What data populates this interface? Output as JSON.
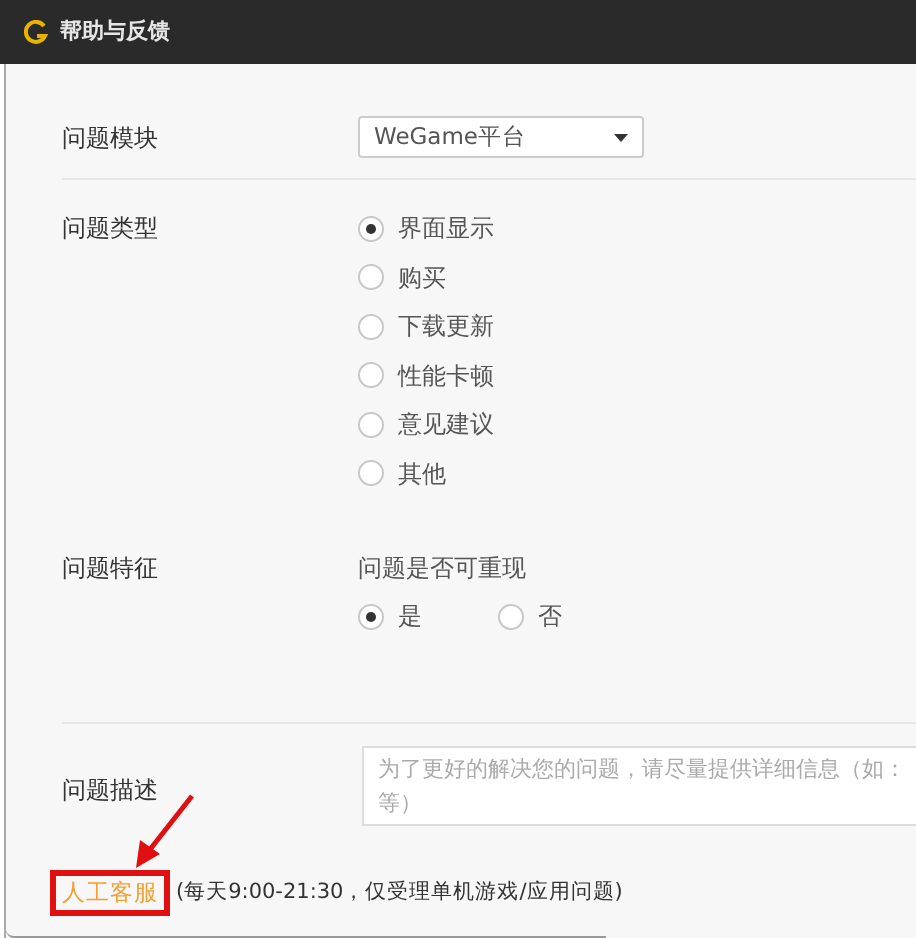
{
  "window": {
    "title": "帮助与反馈"
  },
  "module": {
    "label": "问题模块",
    "value": "WeGame平台"
  },
  "type": {
    "label": "问题类型",
    "options": [
      {
        "label": "界面显示",
        "selected": true
      },
      {
        "label": "购买",
        "selected": false
      },
      {
        "label": "下载更新",
        "selected": false
      },
      {
        "label": "性能卡顿",
        "selected": false
      },
      {
        "label": "意见建议",
        "selected": false
      },
      {
        "label": "其他",
        "selected": false
      }
    ]
  },
  "feature": {
    "label": "问题特征",
    "question": "问题是否可重现",
    "options": [
      {
        "label": "是",
        "selected": true
      },
      {
        "label": "否",
        "selected": false
      }
    ]
  },
  "description": {
    "label": "问题描述",
    "placeholder": "为了更好的解决您的问题，请尽量提供详细信息（如：等）"
  },
  "footer": {
    "link": "人工客服",
    "highlighted": true,
    "note": "(每天9:00-21:30，仅受理单机游戏/应用问题)"
  }
}
